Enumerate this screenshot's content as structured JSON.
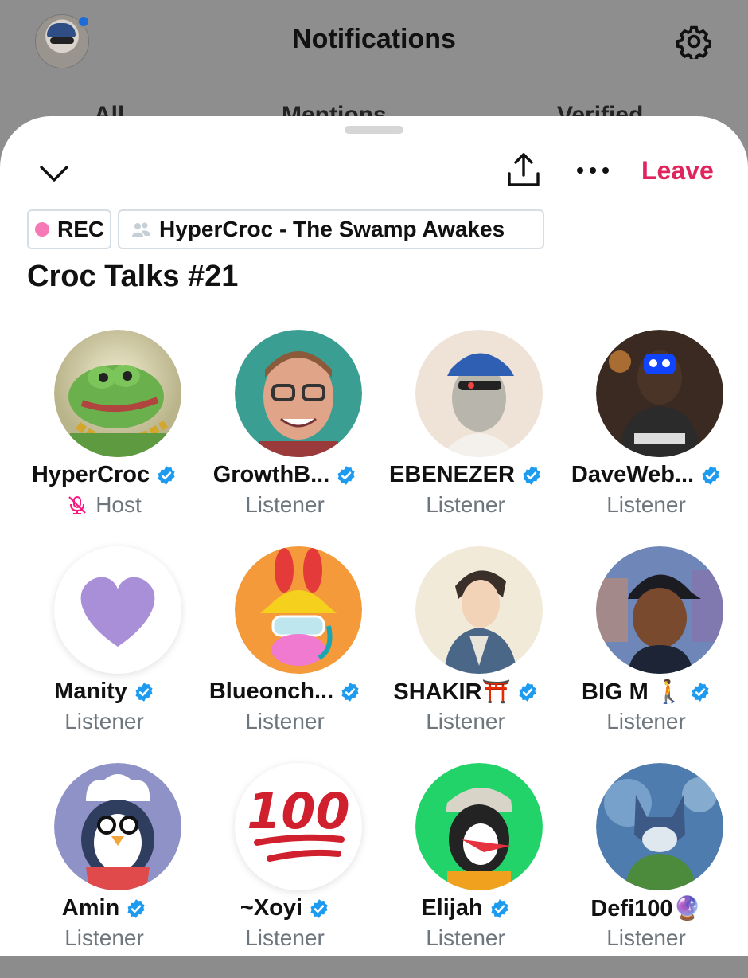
{
  "background": {
    "title": "Notifications",
    "tabs": [
      "All",
      "Mentions",
      "Verified"
    ]
  },
  "sheet": {
    "leave_label": "Leave",
    "rec_label": "REC",
    "community_label": "HyperCroc - The Swamp Awakes",
    "title": "Croc Talks #21"
  },
  "colors": {
    "accent_red": "#e0245e",
    "verified_blue": "#1d9bf0",
    "rec_pink": "#f778b6"
  },
  "participants": [
    {
      "name": "HyperCroc",
      "role": "Host",
      "verified": true
    },
    {
      "name": "GrowthB...",
      "role": "Listener",
      "verified": true
    },
    {
      "name": "EBENEZER",
      "role": "Listener",
      "verified": true
    },
    {
      "name": "DaveWeb...",
      "role": "Listener",
      "verified": true
    },
    {
      "name": "Manity",
      "role": "Listener",
      "verified": true
    },
    {
      "name": "Blueonch...",
      "role": "Listener",
      "verified": true
    },
    {
      "name": "SHAKIR⛩️",
      "role": "Listener",
      "verified": true
    },
    {
      "name": "BIG M 🚶",
      "role": "Listener",
      "verified": true
    },
    {
      "name": "Amin",
      "role": "Listener",
      "verified": true
    },
    {
      "name": "~Xoyi",
      "role": "Listener",
      "verified": true
    },
    {
      "name": "Elijah",
      "role": "Listener",
      "verified": true
    },
    {
      "name": "Defi100🔮",
      "role": "Listener",
      "verified": false
    }
  ]
}
